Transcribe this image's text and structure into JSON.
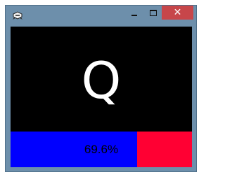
{
  "window": {
    "icon": "app-icon",
    "controls": {
      "minimize_icon": "minimize-icon",
      "maximize_icon": "maximize-icon",
      "close_label": "✕"
    }
  },
  "display": {
    "letter": "Q"
  },
  "progress": {
    "value": 0.696,
    "label": "69.6%",
    "fill_color": "#0000ff",
    "track_color": "#ff0033"
  }
}
